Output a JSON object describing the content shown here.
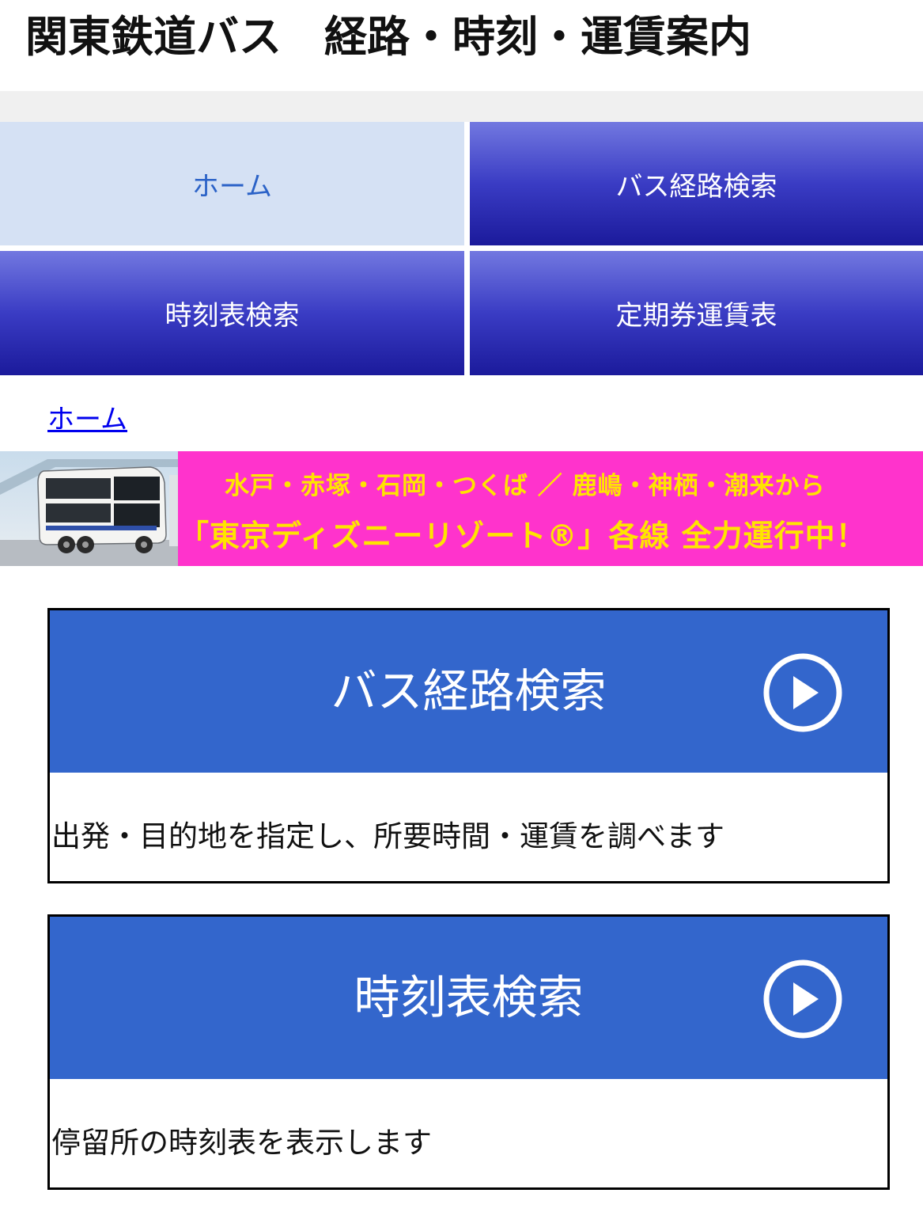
{
  "header": {
    "title": "関東鉄道バス　経路・時刻・運賃案内"
  },
  "nav": {
    "items": [
      {
        "label": "ホーム",
        "active": true
      },
      {
        "label": "バス経路検索",
        "active": false
      },
      {
        "label": "時刻表検索",
        "active": false
      },
      {
        "label": "定期券運賃表",
        "active": false
      }
    ]
  },
  "breadcrumb": {
    "home": "ホーム"
  },
  "banner": {
    "line1": "水戸・赤塚・石岡・つくば ／ 鹿嶋・神栖・潮来から",
    "line2": "「東京ディズニーリゾート®」各線 全力運行中！"
  },
  "cards": [
    {
      "title": "バス経路検索",
      "description": "出発・目的地を指定し、所要時間・運賃を調べます",
      "icon": "play-circle-icon"
    },
    {
      "title": "時刻表検索",
      "description": "停留所の時刻表を表示します",
      "icon": "play-circle-icon"
    }
  ],
  "colors": {
    "nav_active_bg": "#d5e1f4",
    "nav_active_text": "#2b62c7",
    "nav_gradient_top": "#7278e0",
    "nav_gradient_bottom": "#1b1a9b",
    "card_header": "#3366cc",
    "banner_bg": "#ff33cc",
    "banner_text": "#ffe400"
  }
}
